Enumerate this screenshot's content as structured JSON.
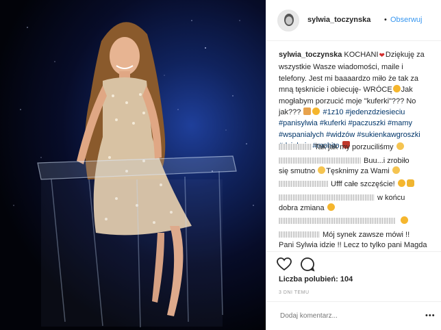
{
  "header": {
    "username": "sylwia_toczynska",
    "separator": "•",
    "follow_label": "Obserwuj"
  },
  "caption": {
    "username": "sylwia_toczynska",
    "text1": "KOCHANI",
    "text2": "Dziękuję za wszystkie Wasze wiadomości, maile i telefony. Jest mi baaaardzo miło że tak za mną tęsknicie i obiecuję- WRÓCĘ",
    "text3": "Jak mogłabym porzucić moje \"kuferki\"??? No jak???",
    "hashtags1": "#1z10 #jedenzdziesieciu",
    "hashtags2": "#panisylwia #kuferki #paczuszki #mamy #wspanialych #widzów #sukienkawgroszki #dziekuje #mohito"
  },
  "comments": [
    {
      "text": "Tak jak my porzuciliśmy"
    },
    {
      "text1": "Buu...i zrobiło",
      "text2": "się smutno",
      "text3": "Tęsknimy za Wami"
    },
    {
      "text": "Ufff całe szczęście!"
    },
    {
      "text1": "w końcu",
      "text2": "dobra zmiana"
    },
    {
      "text": ""
    },
    {
      "text1": "Mój synek zawsze mówi !!",
      "text2": "Pani Sylwia idzie !! Lecz to tylko pani Magda"
    }
  ],
  "actions": {
    "likes_label": "Liczba polubień:",
    "likes_count": "104",
    "date": "3 DNI TEMU",
    "add_comment_placeholder": "Dodaj komentarz...",
    "more": "•••"
  },
  "icons": [
    "heart-icon",
    "comment-icon",
    "more-options-icon"
  ]
}
